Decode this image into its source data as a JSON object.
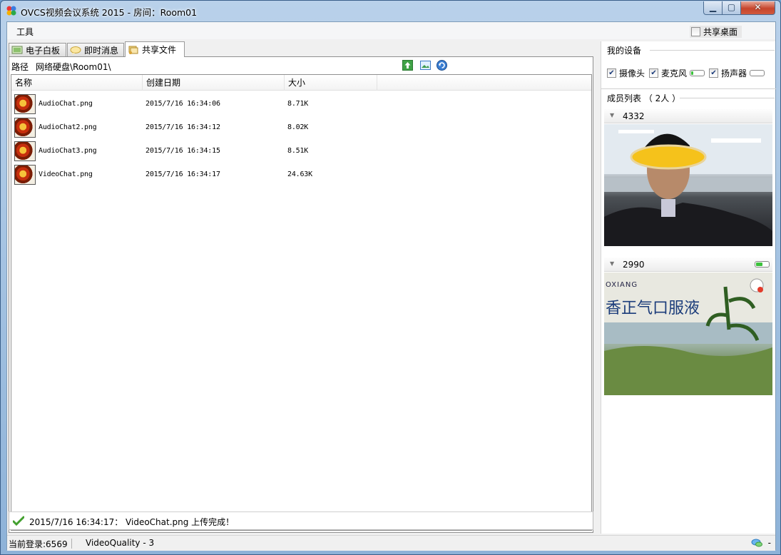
{
  "window": {
    "title": "OVCS视频会议系统 2015 - 房间：Room01",
    "minimize_label": "▁",
    "maximize_label": "▢",
    "close_label": "✕"
  },
  "menu": {
    "tools": "工具",
    "share_desktop": "共享桌面",
    "share_desktop_checked": false
  },
  "tabs": [
    {
      "label": "电子白板",
      "icon": "whiteboard-icon",
      "active": false
    },
    {
      "label": "即时消息",
      "icon": "chat-icon",
      "active": false
    },
    {
      "label": "共享文件",
      "icon": "shared-files-icon",
      "active": true
    }
  ],
  "files": {
    "path_label": "路径",
    "path_value": "网络硬盘\\Room01\\",
    "toolbar_icons": [
      "upload-icon",
      "picture-icon",
      "refresh-icon"
    ],
    "columns": [
      "名称",
      "创建日期",
      "大小"
    ],
    "rows": [
      {
        "name": "AudioChat.png",
        "date": "2015/7/16 16:34:06",
        "size": "8.71K"
      },
      {
        "name": "AudioChat2.png",
        "date": "2015/7/16 16:34:12",
        "size": "8.02K"
      },
      {
        "name": "AudioChat3.png",
        "date": "2015/7/16 16:34:15",
        "size": "8.51K"
      },
      {
        "name": "VideoChat.png",
        "date": "2015/7/16 16:34:17",
        "size": "24.63K"
      }
    ],
    "status_message": "2015/7/16 16:34:17： VideoChat.png 上传完成！"
  },
  "devices": {
    "heading": "我的设备",
    "camera": {
      "label": "摄像头",
      "checked": true
    },
    "microphone": {
      "label": "麦克风",
      "checked": true,
      "level": 0.15
    },
    "speaker": {
      "label": "扬声器",
      "checked": true,
      "level": 0.0
    }
  },
  "members": {
    "heading": "成员列表 （ 2人 ）",
    "list": [
      {
        "id": "4332"
      },
      {
        "id": "2990",
        "mic_level": 0.5,
        "video_overlay_text": "香正气口服液",
        "video_overlay_subtext": "OXIANG"
      }
    ]
  },
  "statusbar": {
    "login": "当前登录:6569",
    "quality": "VideoQuality - 3",
    "right_text": "-"
  },
  "colors": {
    "accent_green": "#3cc13c",
    "title_blue": "#8db2d8"
  }
}
